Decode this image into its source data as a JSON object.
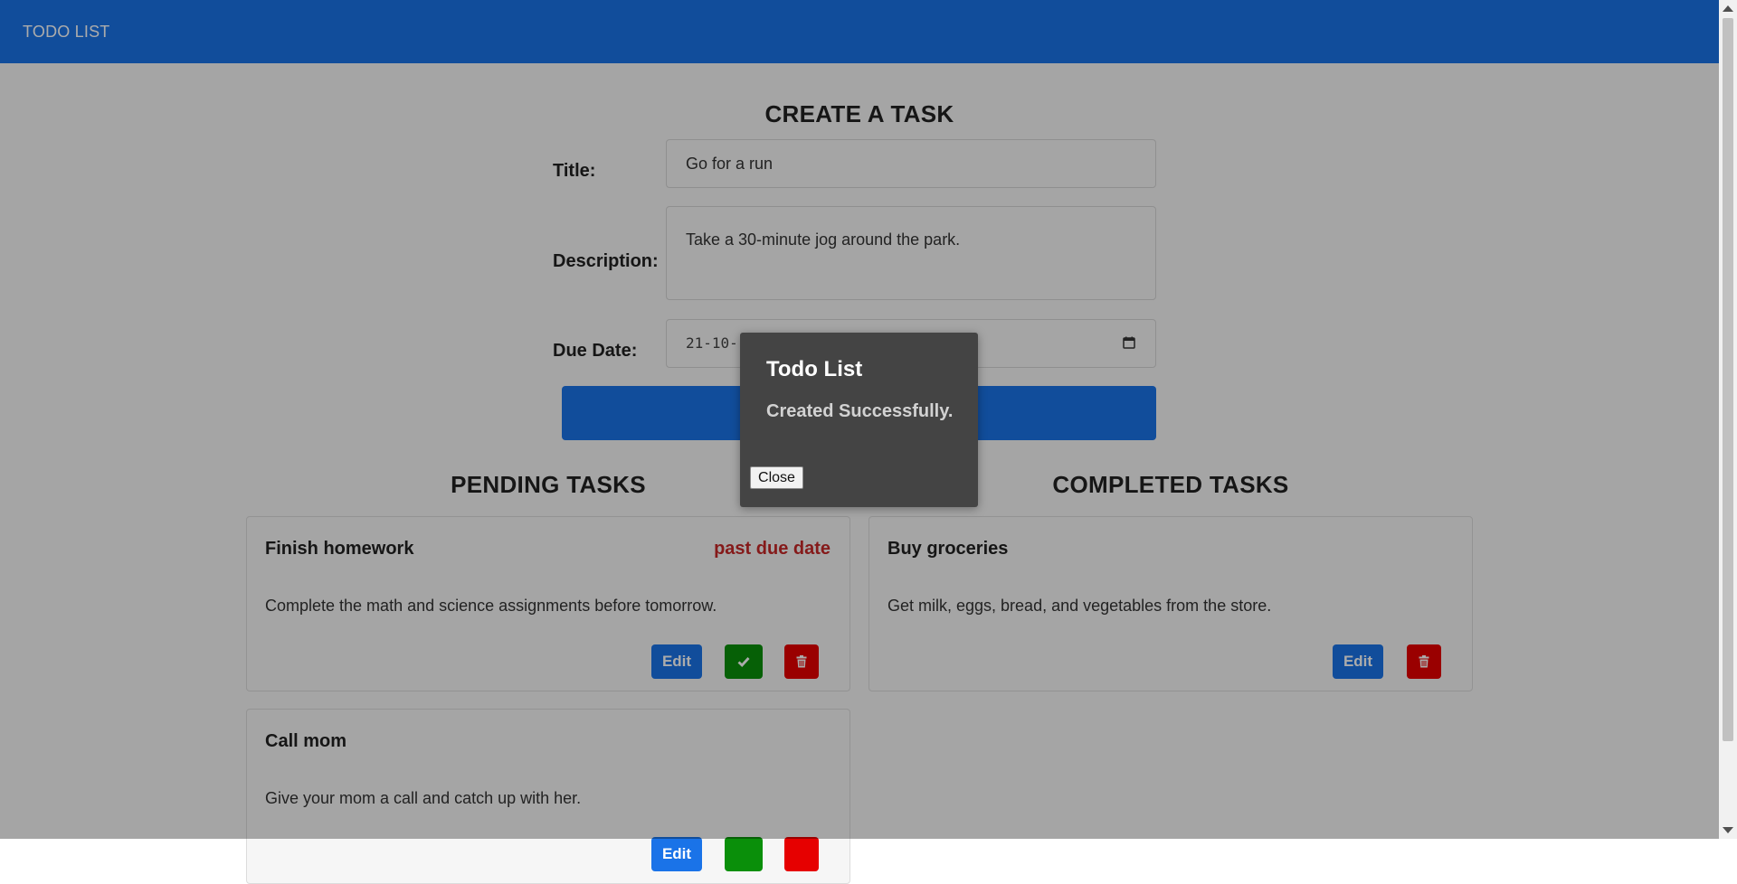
{
  "navbar": {
    "brand": "TODO LIST"
  },
  "create_form": {
    "heading": "CREATE A TASK",
    "title_label": "Title:",
    "title_value": "Go for a run",
    "description_label": "Description:",
    "description_value": "Take a 30-minute jog around the park.",
    "due_date_label": "Due Date:",
    "due_date_value": "21-10-"
  },
  "pending": {
    "heading": "PENDING TASKS",
    "tasks": [
      {
        "title": "Finish homework",
        "status": "past due date",
        "description": "Complete the math and science assignments before tomorrow.",
        "edit_label": "Edit"
      },
      {
        "title": "Call mom",
        "description": "Give your mom a call and catch up with her.",
        "edit_label": "Edit"
      }
    ]
  },
  "completed": {
    "heading": "COMPLETED TASKS",
    "tasks": [
      {
        "title": "Buy groceries",
        "description": "Get milk, eggs, bread, and vegetables from the store.",
        "edit_label": "Edit"
      }
    ]
  },
  "modal": {
    "title": "Todo List",
    "message": "Created Successfully.",
    "close_label": "Close"
  },
  "icons": {
    "complete": "check-icon",
    "delete": "trash-icon",
    "date_picker": "calendar-icon"
  },
  "colors": {
    "primary": "#1a73e8",
    "success": "#0a8f0a",
    "danger": "#e60000",
    "overdue_text": "#c62828",
    "modal_bg": "#444444"
  }
}
